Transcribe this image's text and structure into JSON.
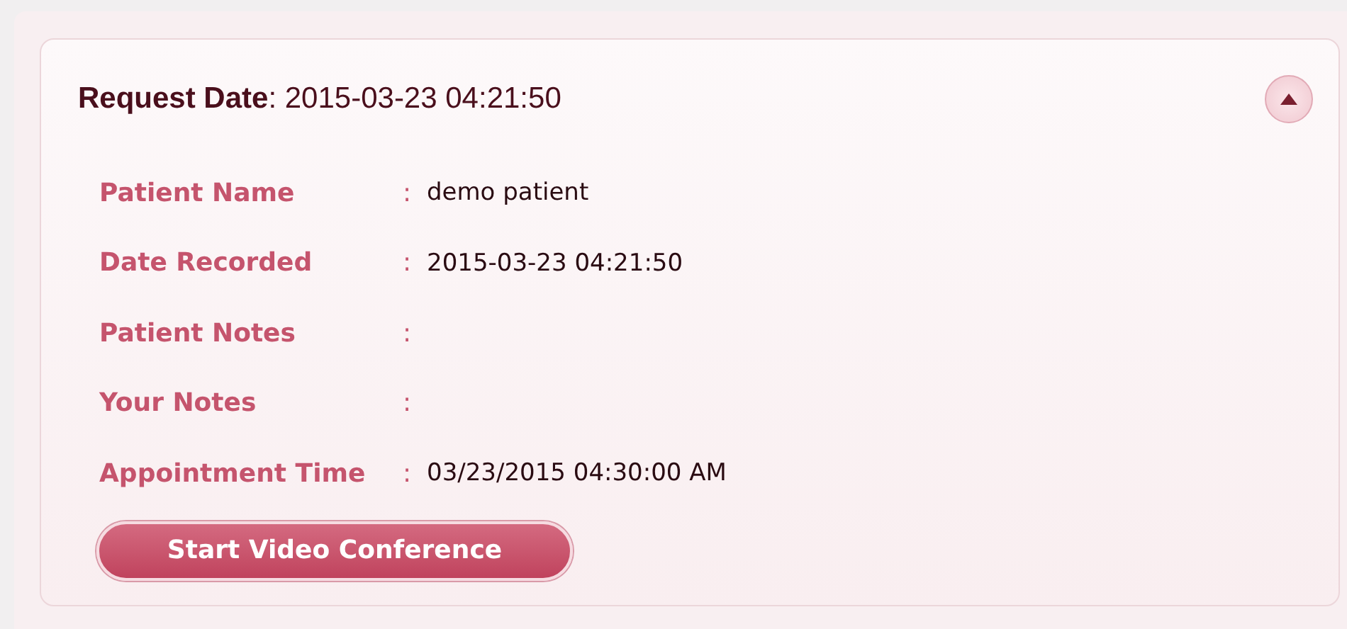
{
  "panel": {
    "title": "**Request Date**: 2015-03-23 04:21:50",
    "expanded": true,
    "fields": [
      {
        "label": "Patient Name",
        "value": "demo patient"
      },
      {
        "label": "Date Recorded",
        "value": "2015-03-23 04:21:50"
      },
      {
        "label": "Patient Notes"
      },
      {
        "label": "Your Notes"
      },
      {
        "label": "Appointment Time",
        "value": "03/23/2015 04:30:00 AM"
      }
    ],
    "separator": ":",
    "button": "Start Video Conference"
  }
}
